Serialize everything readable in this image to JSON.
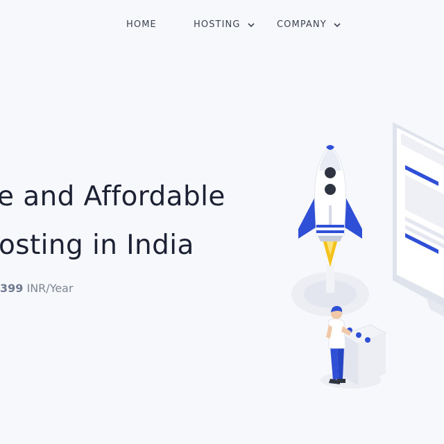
{
  "nav": {
    "items": [
      {
        "label": "HOME",
        "has_dropdown": false
      },
      {
        "label": "HOSTING",
        "has_dropdown": true
      },
      {
        "label": "COMPANY",
        "has_dropdown": true
      }
    ]
  },
  "hero": {
    "line1": "e and Affordable",
    "line2": "osting in India",
    "price_value": "399",
    "price_unit": " INR/Year"
  },
  "colors": {
    "accent": "#2f4fd6",
    "text": "#1c2233",
    "muted": "#7d8592",
    "background": "#f7f8fb",
    "flame": "#f5c21b"
  },
  "icons": [
    "chevron-down-icon",
    "rocket-illustration",
    "monitor-illustration",
    "person-illustration",
    "control-panel-illustration"
  ]
}
